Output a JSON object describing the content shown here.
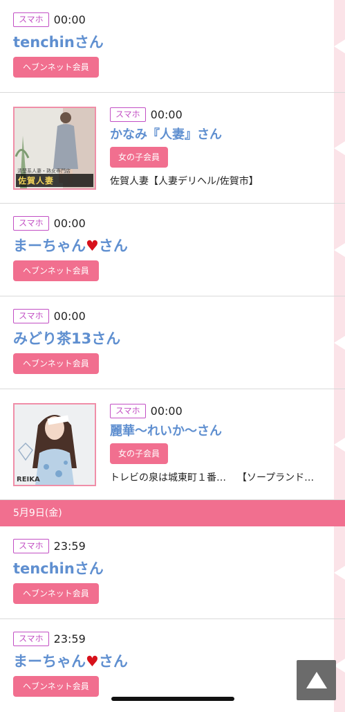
{
  "entries": [
    {
      "device": "スマホ",
      "time": "00:00",
      "name": "tenchinさん",
      "member": "ヘブンネット会員"
    },
    {
      "device": "スマホ",
      "time": "00:00",
      "name": "かなみ『人妻』さん",
      "member": "女の子会員",
      "shop": "佐賀人妻【人妻デリヘル/佐賀市】",
      "photo_caption": "佐賀人妻",
      "photo_sub": "清楚系人妻・熟女専門店"
    },
    {
      "device": "スマホ",
      "time": "00:00",
      "name_prefix": "まーちゃん",
      "name_heart": "♥",
      "name_suffix": "さん",
      "member": "ヘブンネット会員"
    },
    {
      "device": "スマホ",
      "time": "00:00",
      "name": "みどり茶13さん",
      "member": "ヘブンネット会員"
    },
    {
      "device": "スマホ",
      "time": "00:00",
      "name": "麗華〜れいか〜さん",
      "member": "女の子会員",
      "shop": "トレビの泉は城東町１番…",
      "shop_type": "【ソープランド…",
      "photo_mark": "REIKA"
    }
  ],
  "date_separator": "5月9日(金)",
  "entries_after": [
    {
      "device": "スマホ",
      "time": "23:59",
      "name": "tenchinさん",
      "member": "ヘブンネット会員"
    },
    {
      "device": "スマホ",
      "time": "23:59",
      "name_prefix": "まーちゃん",
      "name_heart": "♥",
      "name_suffix": "さん",
      "member": "ヘブンネット会員"
    }
  ],
  "scroll_top_icon": "triangle-up-icon",
  "colors": {
    "accent": "#f16f8f",
    "name": "#5f8fd0",
    "badge_border": "#c24ec4",
    "heart": "#d7111b"
  }
}
